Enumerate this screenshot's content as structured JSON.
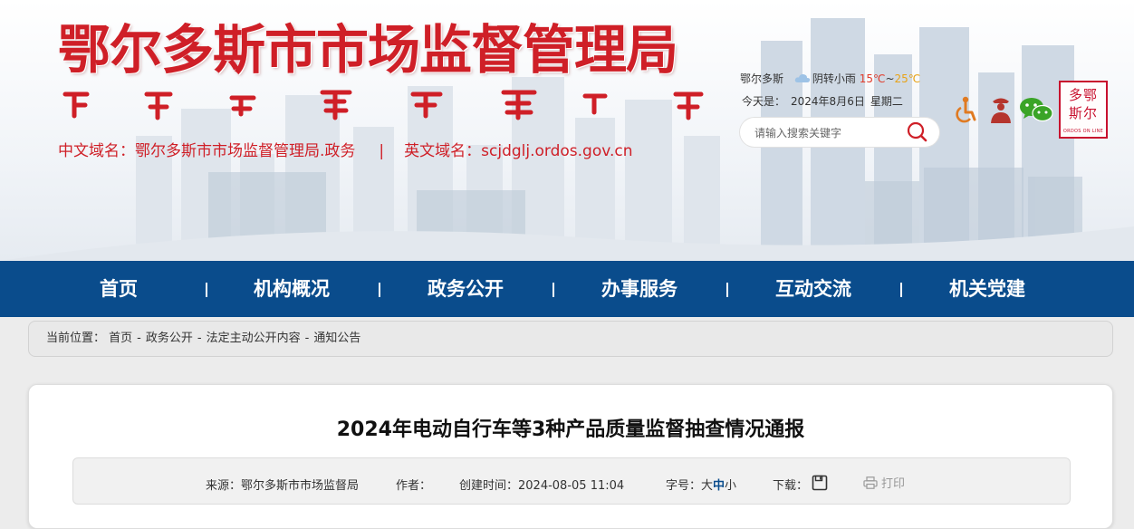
{
  "header": {
    "site_title": "鄂尔多斯市市场监督管理局",
    "cn_domain_label": "中文域名：",
    "cn_domain": "鄂尔多斯市市场监督管理局.政务",
    "divider": "|",
    "en_domain_label": "英文域名：",
    "en_domain": "scjdglj.ordos.gov.cn",
    "weather": {
      "city": "鄂尔多斯",
      "icon": "cloud-icon",
      "condition": "阴转小雨",
      "temp_low": "15℃",
      "range_sep": "~",
      "temp_high": "25℃"
    },
    "date": {
      "label": "今天是：",
      "value": "2024年8月6日",
      "weekday": "星期二"
    },
    "search": {
      "placeholder": "请输入搜索关键字",
      "icon": "search-icon"
    },
    "tools": [
      "accessibility-icon",
      "elderly-mode-icon",
      "wechat-icon"
    ],
    "logo": {
      "chars_line1": "多鄂",
      "chars_line2": "斯尔",
      "en": "ORDOS ON LINE"
    }
  },
  "nav": {
    "items": [
      {
        "label": "首页"
      },
      {
        "label": "机构概况"
      },
      {
        "label": "政务公开"
      },
      {
        "label": "办事服务"
      },
      {
        "label": "互动交流"
      },
      {
        "label": "机关党建"
      }
    ]
  },
  "breadcrumb": {
    "label": "当前位置：",
    "sep": "-",
    "items": [
      "首页",
      "政务公开",
      "法定主动公开内容",
      "通知公告"
    ]
  },
  "article": {
    "title": "2024年电动自行车等3种产品质量监督抽查情况通报",
    "meta": {
      "source_label": "来源：",
      "source": "鄂尔多斯市市场监督局",
      "author_label": "作者：",
      "created_label": "创建时间：",
      "created": "2024-08-05 11:04",
      "font_size_label": "字号：",
      "font_large": "大",
      "font_medium": "中",
      "font_small": "小",
      "download_label": "下载：",
      "download_icon": "save-icon",
      "print_label": "打印",
      "print_icon": "printer-icon"
    }
  },
  "colors": {
    "brand_red": "#cf1f27",
    "nav_blue": "#0a4c8c",
    "temp_low": "#e23b2a",
    "temp_high": "#e8a317"
  }
}
